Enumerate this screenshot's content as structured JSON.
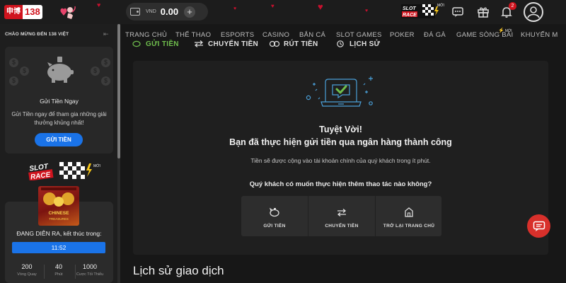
{
  "header": {
    "logo_han": "申博",
    "logo_num": "138",
    "balance_currency": "VND",
    "balance_amount": "0.00",
    "slot_race_new": "MỚI",
    "notification_count": "2"
  },
  "nav": {
    "items": [
      "TRANG CHỦ",
      "THỂ THAO",
      "ESPORTS",
      "CASINO",
      "BẮN CÁ",
      "SLOT GAMES",
      "POKER",
      "ĐÁ GÀ",
      "GAME SÒNG BÀI",
      "KHUYẾN M"
    ],
    "new_tag": "MỚI"
  },
  "sidebar": {
    "welcome": "CHÀO MỪNG ĐẾN 138 VIỆT",
    "deposit_card": {
      "title": "Gửi Tiền Ngay",
      "description": "Gửi Tiền ngay để tham gia những giải thưởng khủng nhất!",
      "button": "GỬI TIỀN"
    },
    "slot_race_new": "MỚI",
    "promo": {
      "thumb_title": "CHINESE",
      "thumb_subtitle": "TREASURES",
      "status": "ĐANG DIỄN RA, kết thúc trong:",
      "timer": "11:52",
      "stats": [
        {
          "value": "200",
          "label": "Vòng Quay"
        },
        {
          "value": "40",
          "label": "Phút"
        },
        {
          "value": "1000",
          "label": "Cược Tối Thiểu"
        }
      ]
    }
  },
  "subtabs": [
    "GỬI TIỀN",
    "CHUYỂN TIỀN",
    "RÚT TIỀN",
    "LỊCH SỬ"
  ],
  "success": {
    "title": "Tuyệt Vời!",
    "message": "Bạn đã thực hiện gửi tiền qua ngân hàng thành công",
    "note": "Tiền sẽ được cộng vào tài khoản chính của quý khách trong ít phút.",
    "question": "Quý khách có muốn thực hiện thêm thao tác nào không?",
    "actions": [
      {
        "label": "GỬI TIỀN",
        "icon": "piggy-bank-icon"
      },
      {
        "label": "CHUYỂN TIỀN",
        "icon": "transfer-icon"
      },
      {
        "label": "TRỞ LẠI TRANG CHỦ",
        "icon": "home-icon"
      }
    ]
  },
  "history": {
    "title": "Lịch sử giao dịch"
  },
  "colors": {
    "accent_blue": "#1a73e8",
    "active_tab_green": "#6fbe4d",
    "chat_red": "#d8302b",
    "brand_red": "#d0141e"
  }
}
